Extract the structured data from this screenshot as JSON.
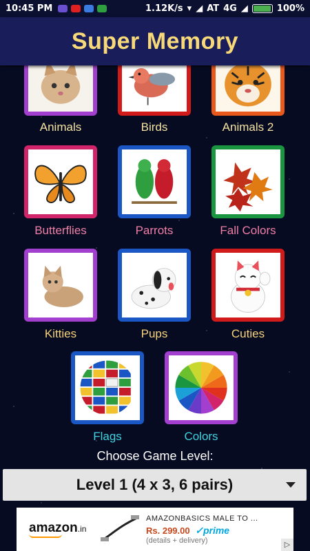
{
  "status_bar": {
    "time": "10:45 PM",
    "speed": "1.12K/s",
    "carrier": "AT",
    "network": "4G",
    "battery": "100%",
    "battery_level": 0.9
  },
  "app": {
    "title": "Super Memory"
  },
  "categories": [
    {
      "label": "Animals",
      "border": "#a33fcf",
      "label_color": "#f4e3a1"
    },
    {
      "label": "Birds",
      "border": "#d11a1a",
      "label_color": "#f4e3a1"
    },
    {
      "label": "Animals 2",
      "border": "#e8591b",
      "label_color": "#f4e3a1"
    },
    {
      "label": "Butterflies",
      "border": "#d2246a",
      "label_color": "#ef7fa6"
    },
    {
      "label": "Parrots",
      "border": "#1b57c4",
      "label_color": "#ef7fa6"
    },
    {
      "label": "Fall Colors",
      "border": "#1a9640",
      "label_color": "#ef7fa6"
    },
    {
      "label": "Kitties",
      "border": "#a33fcf",
      "label_color": "#f7d37b"
    },
    {
      "label": "Pups",
      "border": "#1b57c4",
      "label_color": "#f7d37b"
    },
    {
      "label": "Cuties",
      "border": "#d11a1a",
      "label_color": "#f7d37b"
    },
    {
      "label": "Flags",
      "border": "#1b57c4",
      "label_color": "#3fd3e0"
    },
    {
      "label": "Colors",
      "border": "#a33fcf",
      "label_color": "#3fd3e0"
    }
  ],
  "level": {
    "prompt": "Choose Game Level:",
    "selected": "Level 1 (4 x 3, 6 pairs)"
  },
  "ad": {
    "brand": "amazon",
    "brand_suffix": ".in",
    "title": "AMAZONBASICS MALE TO ...",
    "price": "Rs. 299.00",
    "prime": "prime",
    "note": "(details + delivery)"
  }
}
